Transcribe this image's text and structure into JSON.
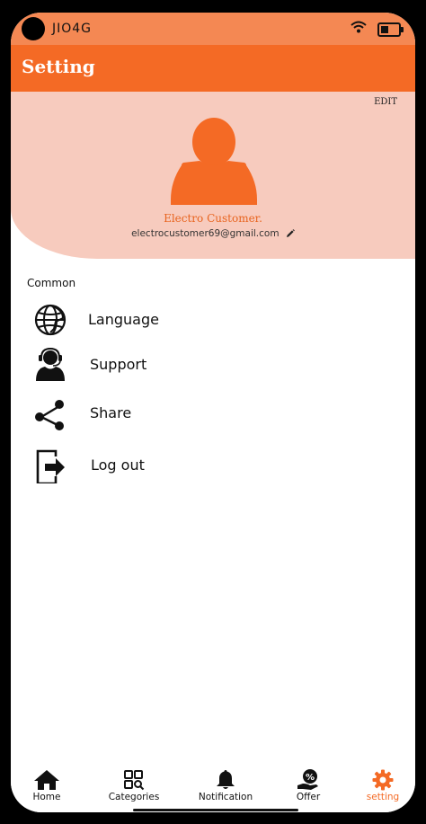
{
  "status_bar": {
    "carrier": "JIO4G"
  },
  "app_bar": {
    "title": "Setting"
  },
  "profile": {
    "edit_label": "EDIT",
    "name": "Electro Customer.",
    "email": "electrocustomer69@gmail.com"
  },
  "menu": {
    "section_title": "Common",
    "items": [
      {
        "label": "Language",
        "icon": "globe-icon"
      },
      {
        "label": "Support",
        "icon": "headset-user-icon"
      },
      {
        "label": "Share",
        "icon": "share-icon"
      },
      {
        "label": "Log out",
        "icon": "logout-icon"
      }
    ]
  },
  "bottom_nav": {
    "items": [
      {
        "label": "Home",
        "icon": "home-icon"
      },
      {
        "label": "Categories",
        "icon": "categories-icon"
      },
      {
        "label": "Notification",
        "icon": "bell-icon"
      },
      {
        "label": "Offer",
        "icon": "offer-icon"
      },
      {
        "label": "setting",
        "icon": "gear-icon",
        "active": true
      }
    ]
  },
  "colors": {
    "status_bar": "#F48853",
    "app_bar": "#F46A25",
    "profile_bg": "#F7CBBE",
    "accent": "#F46A25"
  }
}
